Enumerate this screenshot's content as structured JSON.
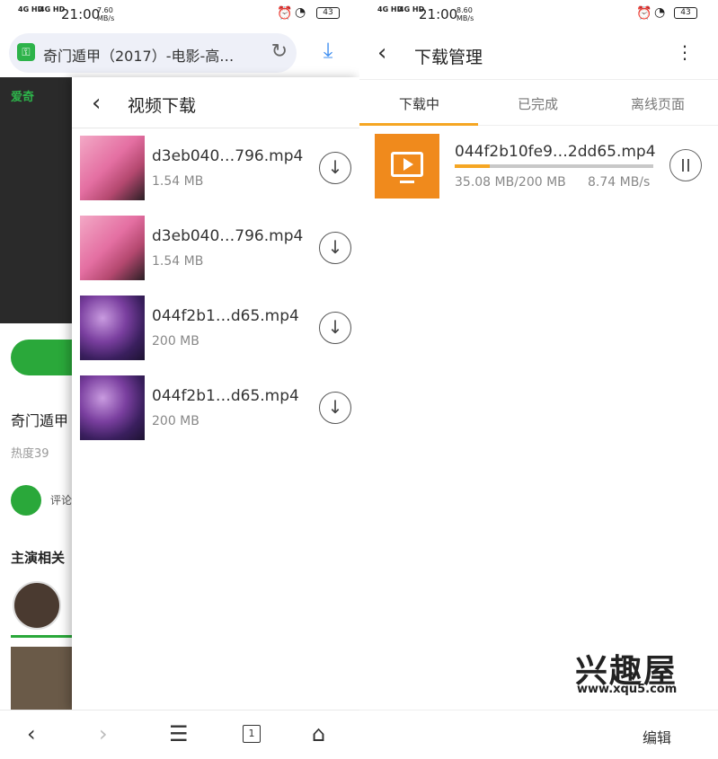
{
  "left": {
    "status": {
      "network1": "4G HD",
      "network2": "4G HD",
      "time": "21:00",
      "speed": "7.60",
      "speed_unit": "MB/s",
      "battery": "43"
    },
    "url_bar": {
      "text": "奇门遁甲（2017）-电影-高…"
    },
    "background_page": {
      "logo": "爱奇",
      "title": "奇门遁甲",
      "heat": "热度39",
      "comment": "评论",
      "section": "主演相关"
    },
    "sheet": {
      "title": "视频下载",
      "items": [
        {
          "name": "d3eb040…796.mp4",
          "size": "1.54 MB"
        },
        {
          "name": "d3eb040…796.mp4",
          "size": "1.54 MB"
        },
        {
          "name": "044f2b1…d65.mp4",
          "size": "200 MB"
        },
        {
          "name": "044f2b1…d65.mp4",
          "size": "200 MB"
        }
      ]
    },
    "nav": {
      "tab_count": "1"
    }
  },
  "right": {
    "status": {
      "network1": "4G HD",
      "network2": "4G HD",
      "time": "21:00",
      "speed": "8.60",
      "speed_unit": "MB/s",
      "battery": "43"
    },
    "header": {
      "title": "下载管理"
    },
    "tabs": [
      "下载中",
      "已完成",
      "离线页面"
    ],
    "active_tab": 0,
    "download": {
      "name": "044f2b10fe9…2dd65.mp4",
      "progress_text": "35.08 MB/200 MB",
      "progress_fraction": 0.1754,
      "speed": "8.74 MB/s"
    },
    "watermark": {
      "main": "兴趣屋",
      "sub": "www.xqu5.com"
    },
    "bottom": {
      "edit": "编辑"
    }
  },
  "colors": {
    "accent_orange": "#f5a623",
    "icon_orange": "#f08a1c",
    "green": "#2db34a",
    "link_blue": "#3b8cf0"
  }
}
